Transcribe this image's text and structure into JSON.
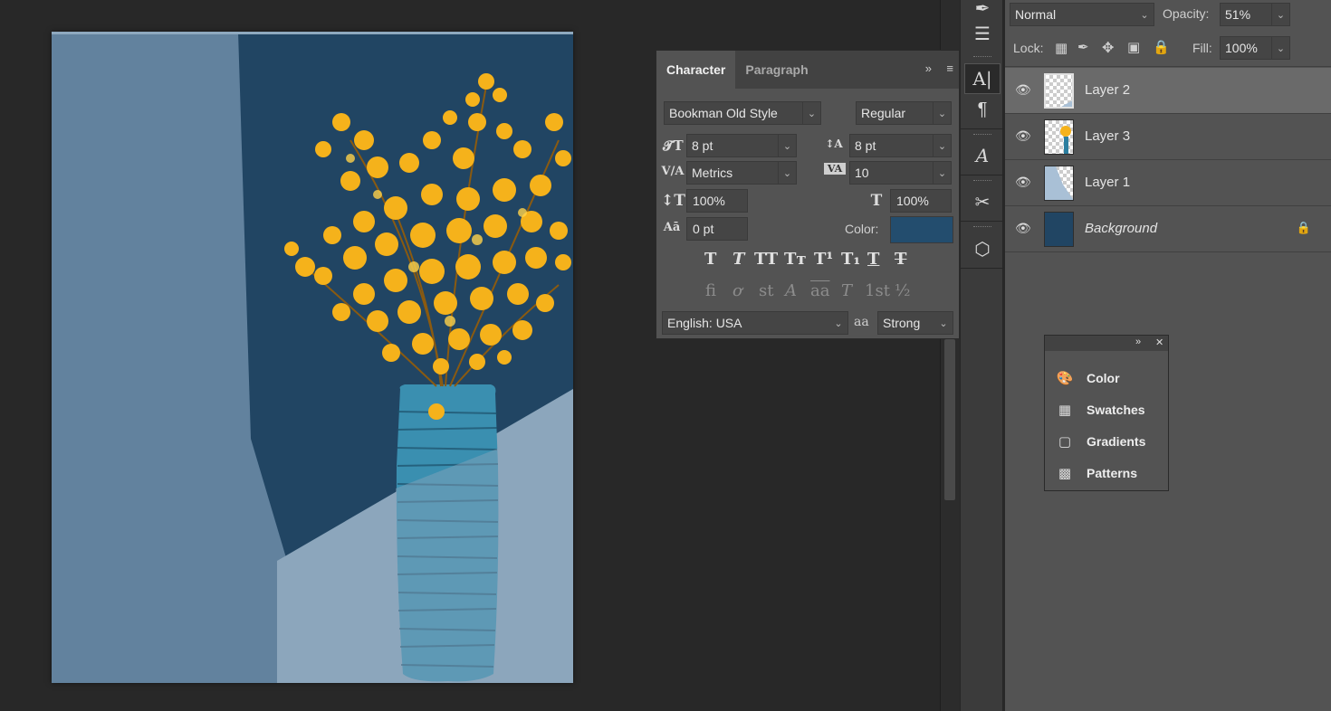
{
  "character_panel": {
    "tabs": [
      "Character",
      "Paragraph"
    ],
    "font_family": "Bookman Old Style",
    "font_style": "Regular",
    "font_size": "8 pt",
    "leading": "8 pt",
    "kerning": "Metrics",
    "tracking": "10",
    "vertical_scale": "100%",
    "horizontal_scale": "100%",
    "baseline_shift": "0 pt",
    "color_label": "Color:",
    "color_value": "#234d6e",
    "language": "English: USA",
    "antialias_icon": "aa",
    "antialias": "Strong",
    "style_buttons": [
      "T",
      "T",
      "TT",
      "Tт",
      "T¹",
      "T₁",
      "T",
      "T"
    ],
    "opentype_buttons": [
      "fi",
      "ơ",
      "st",
      "A",
      "aa",
      "T",
      "1st",
      "½"
    ]
  },
  "tool_icons": [
    "brush-icon",
    "adjustments-icon",
    "character-icon",
    "paragraph-icon",
    "glyphs-icon",
    "tool-presets-icon",
    "3d-icon"
  ],
  "layers_panel": {
    "blend_mode": "Normal",
    "opacity_label": "Opacity:",
    "opacity": "51%",
    "lock_label": "Lock:",
    "fill_label": "Fill:",
    "fill": "100%",
    "layers": [
      {
        "name": "Layer 2",
        "selected": true
      },
      {
        "name": "Layer 3",
        "selected": false
      },
      {
        "name": "Layer 1",
        "selected": false
      },
      {
        "name": "Background",
        "selected": false,
        "locked": true
      }
    ]
  },
  "mini_panel": {
    "items": [
      {
        "label": "Color",
        "icon": "palette-icon"
      },
      {
        "label": "Swatches",
        "icon": "swatches-icon"
      },
      {
        "label": "Gradients",
        "icon": "gradient-icon"
      },
      {
        "label": "Patterns",
        "icon": "patterns-icon"
      }
    ]
  },
  "colors": {
    "doc_light": "#62829e",
    "doc_dark": "#214563",
    "doc_pale": "#8ca6bc",
    "leaves": "#f5b21b",
    "vase": "#3a8fb0"
  }
}
